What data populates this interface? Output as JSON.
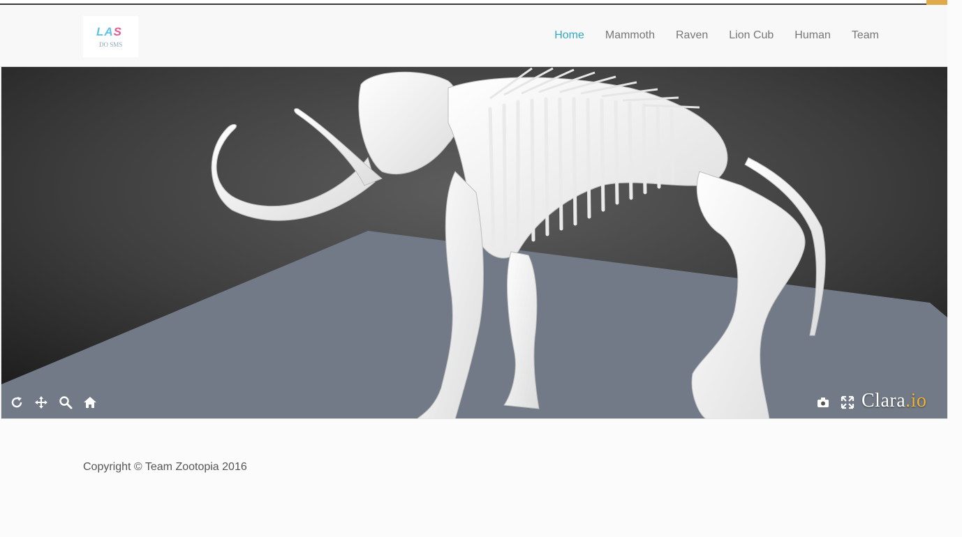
{
  "logo": {
    "mark_a": "LA",
    "mark_b": "S",
    "sub": "DO SMS"
  },
  "nav": {
    "items": [
      {
        "label": "Home",
        "active": true
      },
      {
        "label": "Mammoth",
        "active": false
      },
      {
        "label": "Raven",
        "active": false
      },
      {
        "label": "Lion Cub",
        "active": false
      },
      {
        "label": "Human",
        "active": false
      },
      {
        "label": "Team",
        "active": false
      }
    ]
  },
  "viewer": {
    "brand_main": "Clara",
    "brand_ext": ".io",
    "controls_left": [
      "rotate-icon",
      "pan-icon",
      "zoom-icon",
      "home-icon"
    ],
    "controls_right": [
      "camera-icon",
      "fullscreen-icon"
    ],
    "accent": "#f0b33b"
  },
  "footer": {
    "copyright": "Copyright © Team Zootopia 2016"
  },
  "colors": {
    "nav_active": "#30a9c4",
    "nav_text": "#777777",
    "floor": "#717a86"
  }
}
